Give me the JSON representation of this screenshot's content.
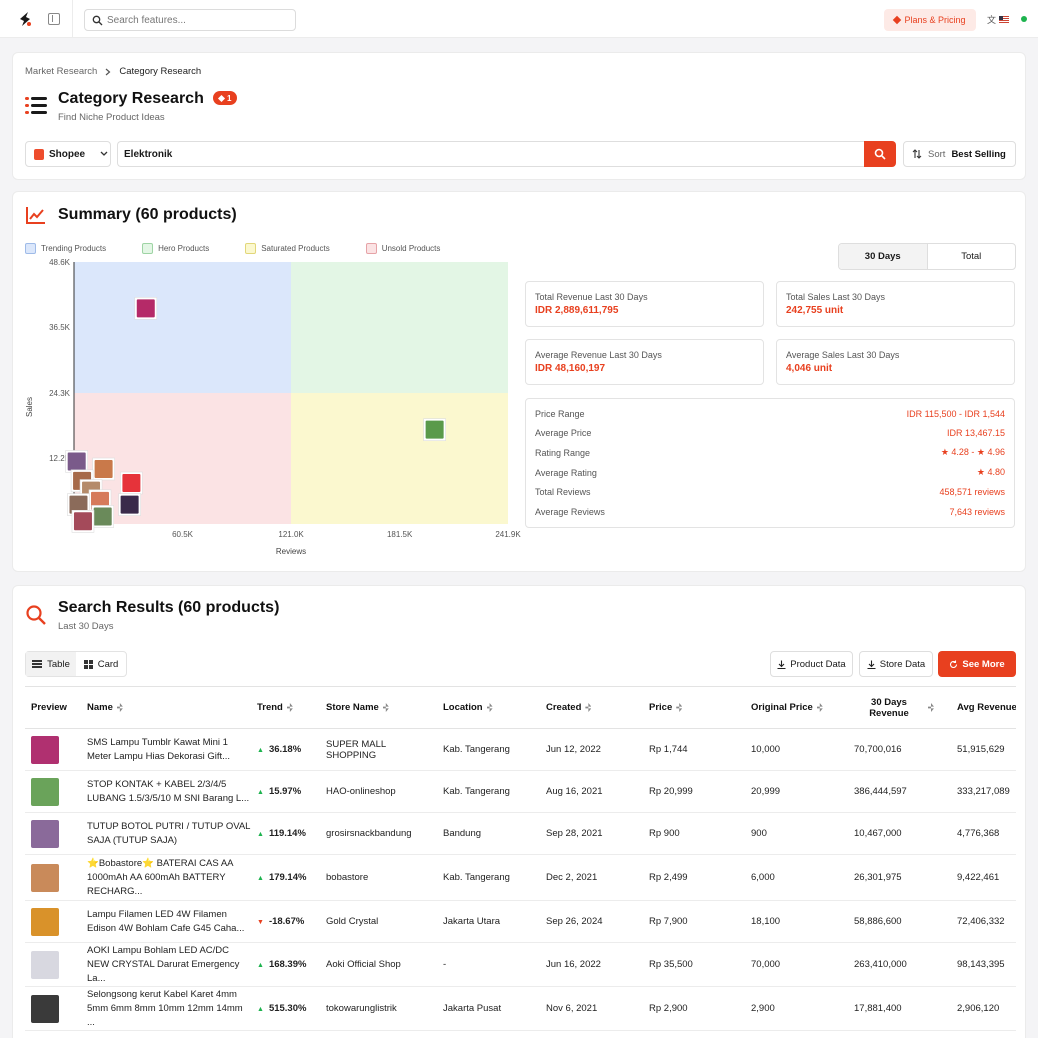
{
  "topbar": {
    "search_placeholder": "Search features...",
    "plans_label": "Plans & Pricing",
    "lang_label": "文",
    "accent": "#e8401f"
  },
  "header": {
    "breadcrumb": [
      "Market Research",
      "Category Research"
    ],
    "title": "Category Research",
    "badge": "1",
    "subtitle": "Find Niche Product Ideas",
    "platform": "Shopee",
    "keyword": "Elektronik",
    "sort_label": "Sort",
    "sort_value": "Best Selling"
  },
  "summary": {
    "title": "Summary (60 products)",
    "tabs": [
      "30 Days",
      "Total"
    ],
    "stats": [
      {
        "label": "Total Revenue Last 30 Days",
        "value": "IDR 2,889,611,795"
      },
      {
        "label": "Total Sales Last 30 Days",
        "value": "242,755 unit"
      },
      {
        "label": "Average Revenue Last 30 Days",
        "value": "IDR 48,160,197"
      },
      {
        "label": "Average Sales Last 30 Days",
        "value": "4,046 unit"
      }
    ],
    "details": [
      {
        "label": "Price Range",
        "value": "IDR 115,500 - IDR 1,544"
      },
      {
        "label": "Average Price",
        "value": "IDR 13,467.15"
      },
      {
        "label": "Rating Range",
        "value": "★ 4.28 - ★ 4.96"
      },
      {
        "label": "Average Rating",
        "value": "★ 4.80"
      },
      {
        "label": "Total Reviews",
        "value": "458,571 reviews"
      },
      {
        "label": "Average Reviews",
        "value": "7,643 reviews"
      }
    ]
  },
  "chart_data": {
    "type": "scatter",
    "xlabel": "Reviews",
    "ylabel": "Sales",
    "xlim": [
      0,
      241900
    ],
    "ylim": [
      0,
      48600
    ],
    "x_ticks": [
      "60.5K",
      "121.0K",
      "181.5K",
      "241.9K"
    ],
    "y_ticks": [
      "48.6K",
      "36.5K",
      "24.3K",
      "12.2K"
    ],
    "legend": [
      {
        "name": "Trending Products",
        "color": "#dbe7fb",
        "border": "#9fbbe8"
      },
      {
        "name": "Hero Products",
        "color": "#e3f6e5",
        "border": "#9ed4a4"
      },
      {
        "name": "Saturated Products",
        "color": "#fbf8cf",
        "border": "#e2d77a"
      },
      {
        "name": "Unsold Products",
        "color": "#fbe3e4",
        "border": "#e6a3a7"
      }
    ],
    "points": [
      {
        "x": 40000,
        "y": 40000,
        "color": "#b52a68"
      },
      {
        "x": 201000,
        "y": 17500,
        "color": "#5a9a4a"
      },
      {
        "x": 1500,
        "y": 11600,
        "color": "#7a5a8a"
      },
      {
        "x": 16500,
        "y": 10200,
        "color": "#c9794a"
      },
      {
        "x": 32000,
        "y": 7600,
        "color": "#e6333a"
      },
      {
        "x": 4500,
        "y": 8000,
        "color": "#a66a4a"
      },
      {
        "x": 9500,
        "y": 6200,
        "color": "#b58b6a"
      },
      {
        "x": 31000,
        "y": 3600,
        "color": "#3a2a4a"
      },
      {
        "x": 14500,
        "y": 4300,
        "color": "#d67a5a"
      },
      {
        "x": 2500,
        "y": 3600,
        "color": "#8b6b5a"
      },
      {
        "x": 16000,
        "y": 1400,
        "color": "#6a8a5a"
      },
      {
        "x": 5000,
        "y": 500,
        "color": "#a44a5a"
      }
    ]
  },
  "results": {
    "title": "Search Results (60 products)",
    "subtitle": "Last 30 Days",
    "view_tabs": [
      "Table",
      "Card"
    ],
    "buttons": {
      "product_data": "Product Data",
      "store_data": "Store Data",
      "see_more": "See More"
    },
    "columns": [
      "Preview",
      "Name",
      "Trend",
      "Store Name",
      "Location",
      "Created",
      "Price",
      "Original Price",
      "30 Days Revenue",
      "Avg Revenue"
    ],
    "rows": [
      {
        "name": "SMS Lampu Tumblr Kawat Mini 1 Meter Lampu Hias Dekorasi Gift...",
        "trend": "36.18%",
        "trend_dir": "up",
        "store": "SUPER MALL SHOPPING",
        "location": "Kab. Tangerang",
        "created": "Jun 12, 2022",
        "price": "Rp 1,744",
        "original": "10,000",
        "revenue": "70,700,016",
        "avg": "51,915,629",
        "thumb": "#b03070"
      },
      {
        "name": "STOP KONTAK + KABEL 2/3/4/5 LUBANG 1.5/3/5/10 M SNI Barang L...",
        "trend": "15.97%",
        "trend_dir": "up",
        "store": "HAO-onlineshop",
        "location": "Kab. Tangerang",
        "created": "Aug 16, 2021",
        "price": "Rp 20,999",
        "original": "20,999",
        "revenue": "386,444,597",
        "avg": "333,217,089",
        "thumb": "#6aa35a"
      },
      {
        "name": "TUTUP BOTOL PUTRI / TUTUP OVAL SAJA (TUTUP SAJA)",
        "trend": "119.14%",
        "trend_dir": "up",
        "store": "grosirsnackbandung",
        "location": "Bandung",
        "created": "Sep 28, 2021",
        "price": "Rp 900",
        "original": "900",
        "revenue": "10,467,000",
        "avg": "4,776,368",
        "thumb": "#8a6a9a"
      },
      {
        "name": "⭐Bobastore⭐ BATERAI CAS AA 1000mAh AA 600mAh BATTERY RECHARG...",
        "trend": "179.14%",
        "trend_dir": "up",
        "store": "bobastore",
        "location": "Kab. Tangerang",
        "created": "Dec 2, 2021",
        "price": "Rp 2,499",
        "original": "6,000",
        "revenue": "26,301,975",
        "avg": "9,422,461",
        "thumb": "#c98a5a"
      },
      {
        "name": "Lampu Filamen LED 4W Filamen Edison 4W Bohlam Cafe G45 Caha...",
        "trend": "-18.67%",
        "trend_dir": "down",
        "store": "Gold Crystal",
        "location": "Jakarta Utara",
        "created": "Sep 26, 2024",
        "price": "Rp 7,900",
        "original": "18,100",
        "revenue": "58,886,600",
        "avg": "72,406,332",
        "thumb": "#d9922a"
      },
      {
        "name": "AOKI Lampu Bohlam LED AC/DC NEW CRYSTAL Darurat Emergency La...",
        "trend": "168.39%",
        "trend_dir": "up",
        "store": "Aoki Official Shop",
        "location": "-",
        "created": "Jun 16, 2022",
        "price": "Rp 35,500",
        "original": "70,000",
        "revenue": "263,410,000",
        "avg": "98,143,395",
        "thumb": "#d8d8e0"
      },
      {
        "name": "Selongsong kerut Kabel Karet 4mm 5mm 6mm 8mm 10mm 12mm 14mm ...",
        "trend": "515.30%",
        "trend_dir": "up",
        "store": "tokowarunglistrik",
        "location": "Jakarta Pusat",
        "created": "Nov 6, 2021",
        "price": "Rp 2,900",
        "original": "2,900",
        "revenue": "17,881,400",
        "avg": "2,906,120",
        "thumb": "#3a3a3a"
      }
    ]
  }
}
